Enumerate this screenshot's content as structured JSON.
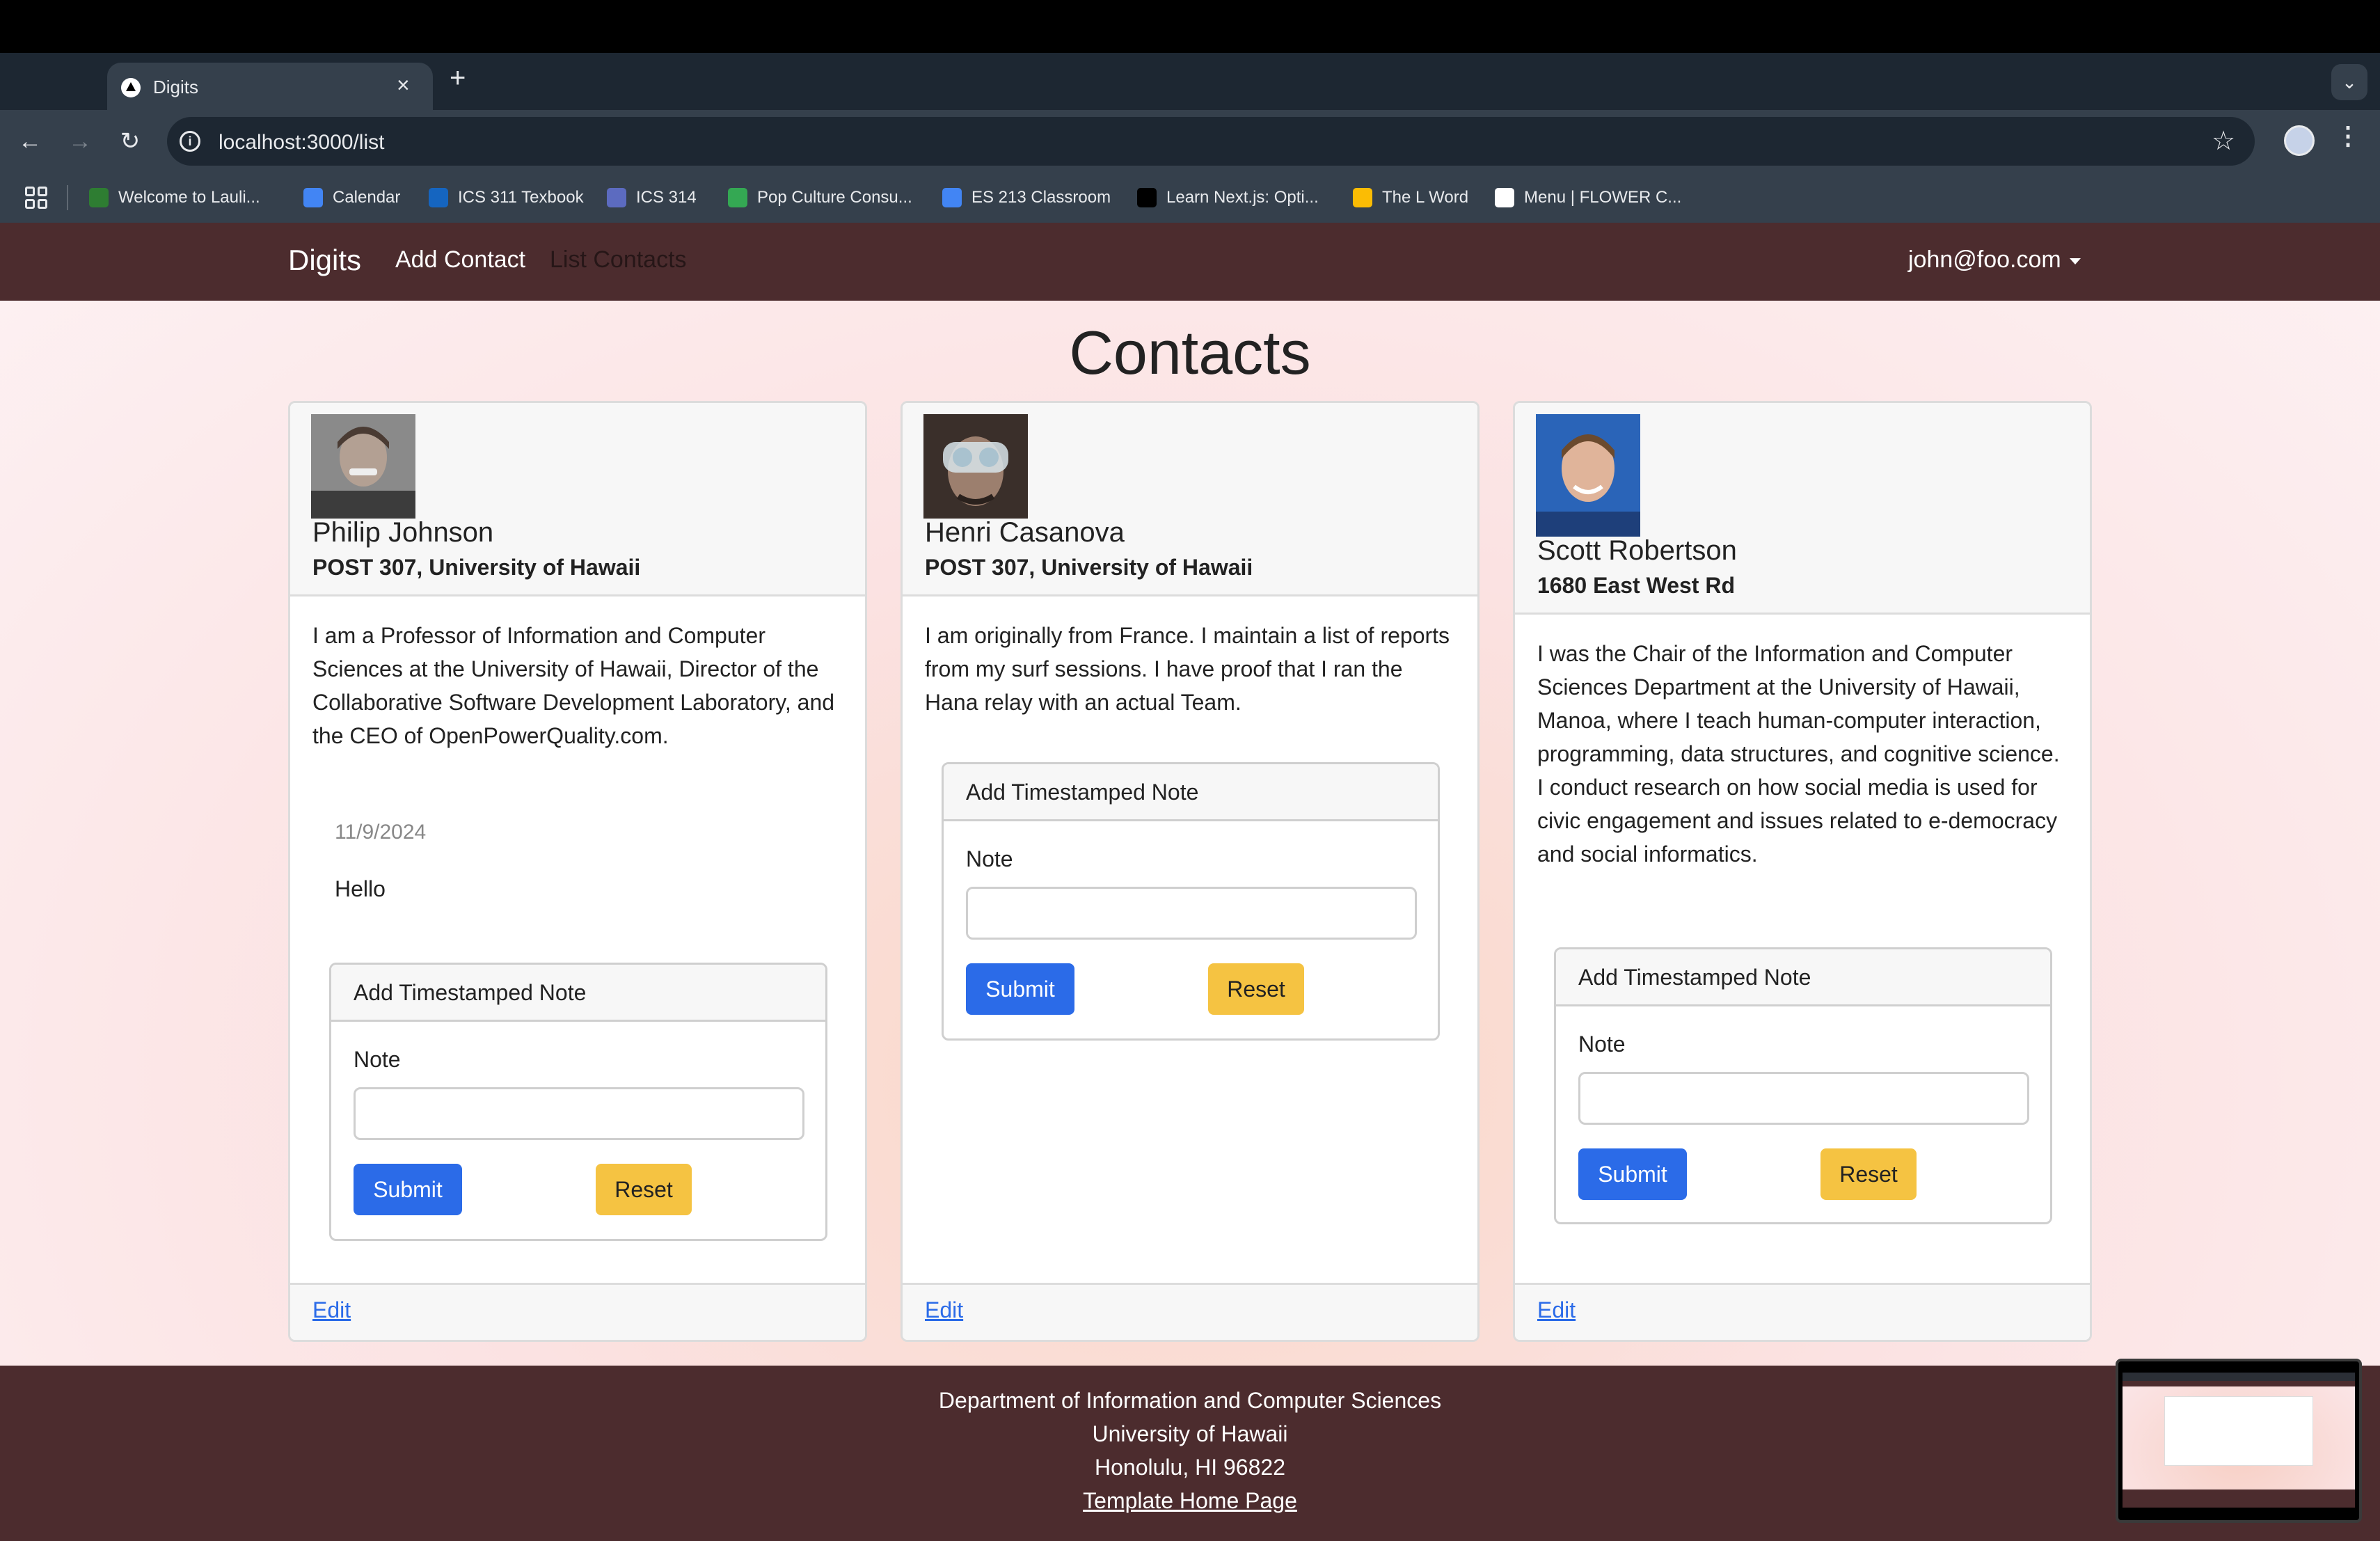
{
  "browser": {
    "tab_title": "Digits",
    "tab_close": "×",
    "new_tab": "+",
    "tab_menu": "⌄",
    "url": "localhost:3000/list",
    "info_glyph": "i",
    "star_glyph": "☆",
    "kebab_glyph": "⋮",
    "nav_back_glyph": "←",
    "nav_forward_glyph": "→",
    "nav_reload_glyph": "↻",
    "bookmarks": [
      {
        "label": "Welcome to Lauli...",
        "color": "#2e7d32"
      },
      {
        "label": "Calendar",
        "color": "#4285f4"
      },
      {
        "label": "ICS 311 Texbook",
        "color": "#1565c0"
      },
      {
        "label": "ICS 314",
        "color": "#5c6bc0"
      },
      {
        "label": "Pop Culture Consu...",
        "color": "#34a853"
      },
      {
        "label": "ES 213 Classroom",
        "color": "#4285f4"
      },
      {
        "label": "Learn Next.js: Opti...",
        "color": "#000000"
      },
      {
        "label": "The L Word",
        "color": "#fbbc04"
      },
      {
        "label": "Menu | FLOWER C...",
        "color": "#ffffff"
      }
    ]
  },
  "navbar": {
    "brand": "Digits",
    "add_contact": "Add Contact",
    "list_contacts": "List Contacts",
    "user": "john@foo.com"
  },
  "page": {
    "title": "Contacts"
  },
  "form": {
    "header": "Add Timestamped Note",
    "label": "Note",
    "submit": "Submit",
    "reset": "Reset"
  },
  "contacts": [
    {
      "name": "Philip Johnson",
      "address": "POST 307, University of Hawaii",
      "bio": "I am a Professor of Information and Computer Sciences at the University of Hawaii, Director of the Collaborative Software Development Laboratory, and the CEO of OpenPowerQuality.com.",
      "notes": [
        {
          "date": "11/9/2024",
          "text": "Hello"
        }
      ],
      "edit": "Edit"
    },
    {
      "name": "Henri Casanova",
      "address": "POST 307, University of Hawaii",
      "bio": "I am originally from France. I maintain a list of reports from my surf sessions. I have proof that I ran the Hana relay with an actual Team.",
      "notes": [],
      "edit": "Edit"
    },
    {
      "name": "Scott Robertson",
      "address": "1680 East West Rd",
      "bio": "I was the Chair of the Information and Computer Sciences Department at the University of Hawaii, Manoa, where I teach human-computer interaction, programming, data structures, and cognitive science. I conduct research on how social media is used for civic engagement and issues related to e-democracy and social informatics.",
      "notes": [],
      "edit": "Edit"
    }
  ],
  "footer": {
    "line1": "Department of Information and Computer Sciences",
    "line2": "University of Hawaii",
    "line3": "Honolulu, HI 96822",
    "link": "Template Home Page"
  },
  "colors": {
    "navbar": "#4c2c2e",
    "submit": "#2b6be8",
    "reset": "#f5c342",
    "link": "#2b6be8"
  }
}
